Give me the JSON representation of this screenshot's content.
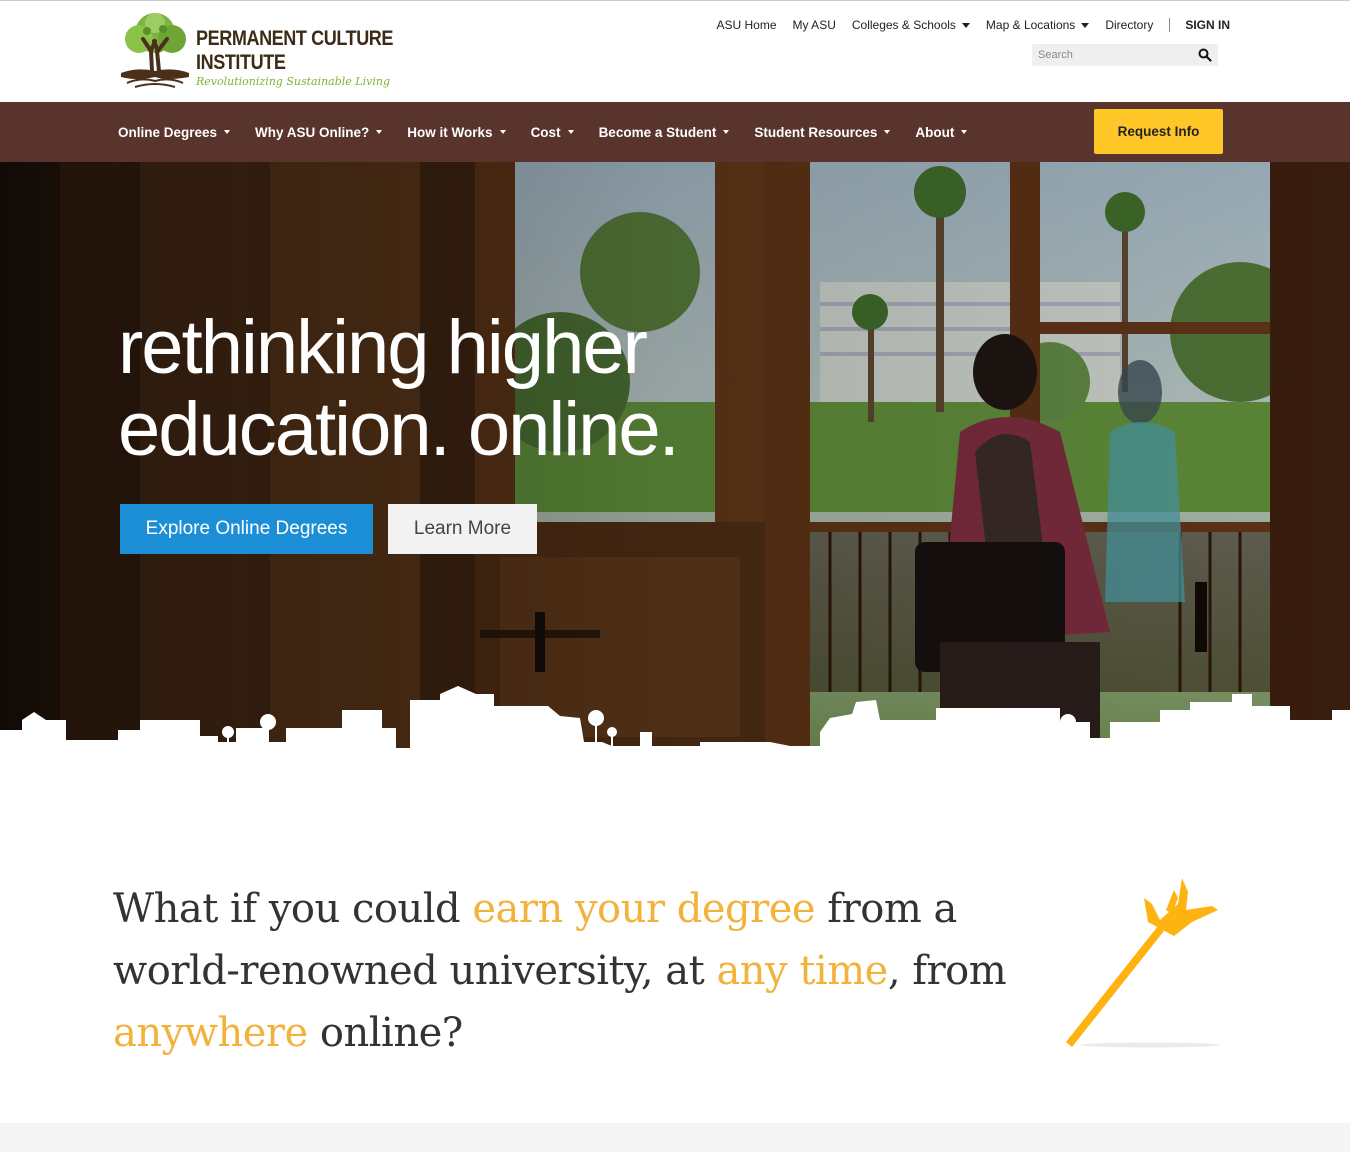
{
  "logo": {
    "title_line1": "PERMANENT CULTURE",
    "title_line2": "INSTITUTE",
    "tagline": "Revolutionizing Sustainable Living",
    "icon": "tree-logo-icon"
  },
  "util_nav": {
    "items": [
      {
        "label": "ASU Home",
        "dropdown": false
      },
      {
        "label": "My ASU",
        "dropdown": false
      },
      {
        "label": "Colleges & Schools",
        "dropdown": true
      },
      {
        "label": "Map & Locations",
        "dropdown": true
      },
      {
        "label": "Directory",
        "dropdown": false
      }
    ],
    "sign_in": "SIGN IN"
  },
  "search": {
    "placeholder": "Search",
    "icon": "search-icon"
  },
  "main_nav": {
    "items": [
      {
        "label": "Online Degrees"
      },
      {
        "label": "Why ASU Online?"
      },
      {
        "label": "How it Works"
      },
      {
        "label": "Cost"
      },
      {
        "label": "Become a Student"
      },
      {
        "label": "Student Resources"
      },
      {
        "label": "About"
      }
    ],
    "request_info": "Request Info"
  },
  "hero": {
    "headline_line1": "rethinking higher",
    "headline_line2": "education. online.",
    "primary_button": "Explore Online Degrees",
    "secondary_button": "Learn More"
  },
  "intro": {
    "part1": "What if you could ",
    "highlight1": "earn your degree",
    "part2": " from a world-renowned university, at ",
    "highlight2": "any time",
    "part3": ", from ",
    "highlight3": "anywhere",
    "part4": " online?",
    "icon": "pitchfork-icon"
  },
  "colors": {
    "nav_bg": "#58342c",
    "accent_gold": "#ffc627",
    "highlight_text": "#f2b33c",
    "primary_blue": "#1c8ed6"
  }
}
